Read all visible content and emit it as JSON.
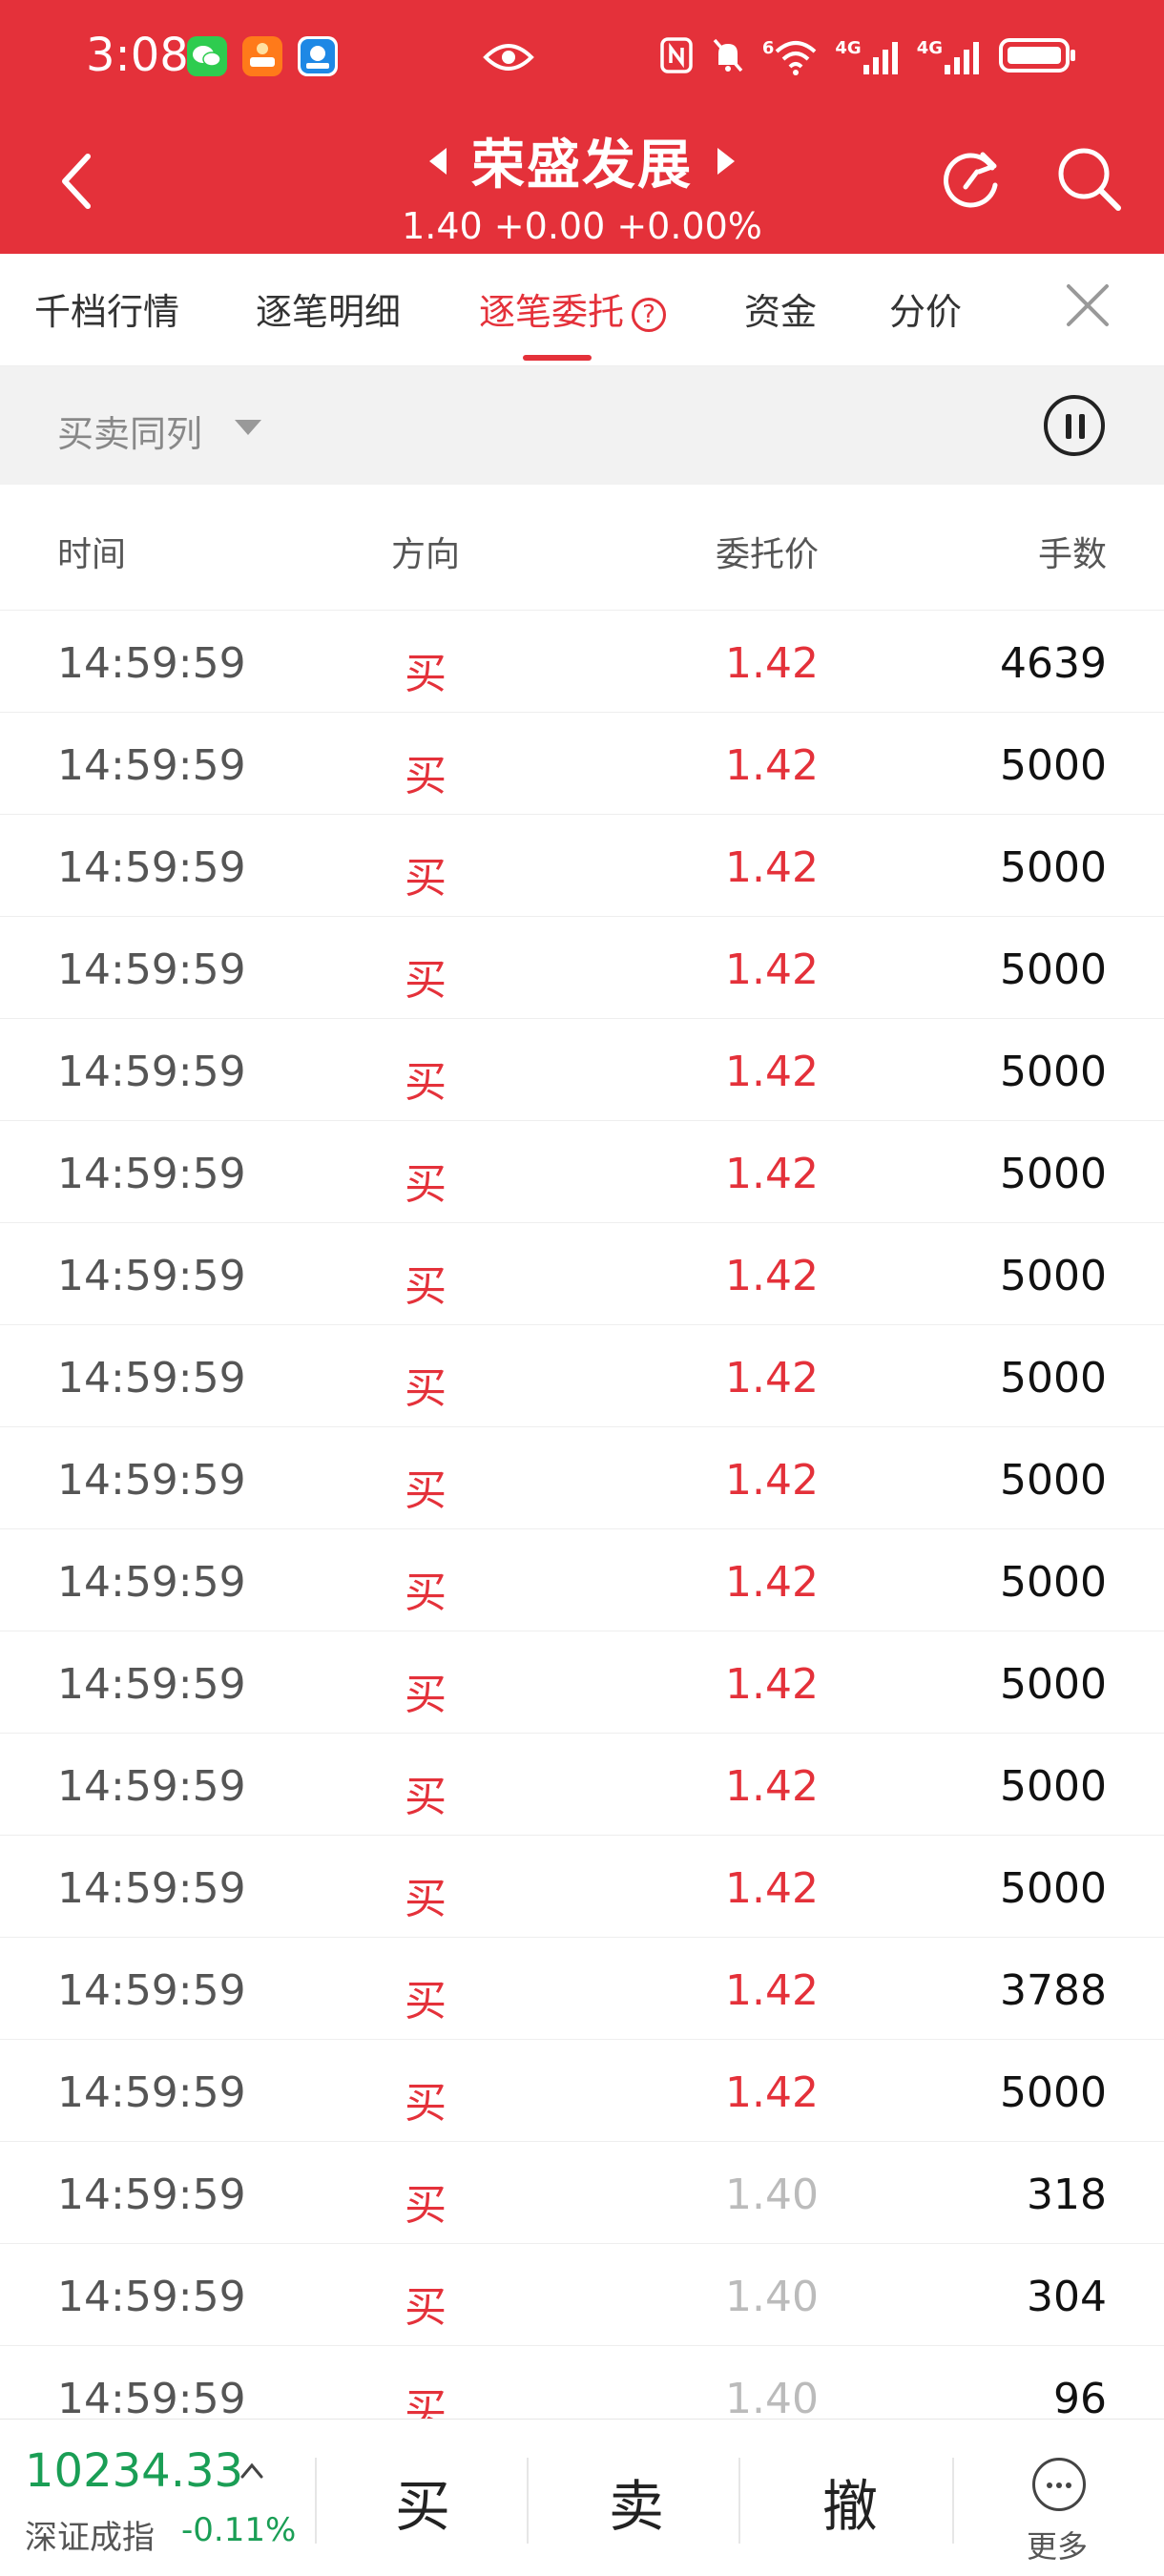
{
  "status_bar": {
    "time": "3:08",
    "apps": [
      "wechat-icon",
      "loan-app-icon",
      "blue-app-icon"
    ],
    "network_labels": [
      "6",
      "4G",
      "4G"
    ]
  },
  "header": {
    "title": "荣盛发展",
    "subtitle": "1.40 +0.00 +0.00%",
    "colors": {
      "bg": "#e4313a",
      "text": "#ffffff"
    }
  },
  "tabs": [
    {
      "label": "千档行情"
    },
    {
      "label": "逐笔明细"
    },
    {
      "label": "逐笔委托",
      "active": true
    },
    {
      "label": "资金"
    },
    {
      "label": "分价"
    }
  ],
  "filter": {
    "label": "买卖同列"
  },
  "table": {
    "headers": [
      "时间",
      "方向",
      "委托价",
      "手数"
    ],
    "rows": [
      {
        "time": "14:59:59",
        "dir": "买",
        "price": "1.42",
        "vol": "4639",
        "state": "up"
      },
      {
        "time": "14:59:59",
        "dir": "买",
        "price": "1.42",
        "vol": "5000",
        "state": "up"
      },
      {
        "time": "14:59:59",
        "dir": "买",
        "price": "1.42",
        "vol": "5000",
        "state": "up"
      },
      {
        "time": "14:59:59",
        "dir": "买",
        "price": "1.42",
        "vol": "5000",
        "state": "up"
      },
      {
        "time": "14:59:59",
        "dir": "买",
        "price": "1.42",
        "vol": "5000",
        "state": "up"
      },
      {
        "time": "14:59:59",
        "dir": "买",
        "price": "1.42",
        "vol": "5000",
        "state": "up"
      },
      {
        "time": "14:59:59",
        "dir": "买",
        "price": "1.42",
        "vol": "5000",
        "state": "up"
      },
      {
        "time": "14:59:59",
        "dir": "买",
        "price": "1.42",
        "vol": "5000",
        "state": "up"
      },
      {
        "time": "14:59:59",
        "dir": "买",
        "price": "1.42",
        "vol": "5000",
        "state": "up"
      },
      {
        "time": "14:59:59",
        "dir": "买",
        "price": "1.42",
        "vol": "5000",
        "state": "up"
      },
      {
        "time": "14:59:59",
        "dir": "买",
        "price": "1.42",
        "vol": "5000",
        "state": "up"
      },
      {
        "time": "14:59:59",
        "dir": "买",
        "price": "1.42",
        "vol": "5000",
        "state": "up"
      },
      {
        "time": "14:59:59",
        "dir": "买",
        "price": "1.42",
        "vol": "5000",
        "state": "up"
      },
      {
        "time": "14:59:59",
        "dir": "买",
        "price": "1.42",
        "vol": "3788",
        "state": "up"
      },
      {
        "time": "14:59:59",
        "dir": "买",
        "price": "1.42",
        "vol": "5000",
        "state": "up"
      },
      {
        "time": "14:59:59",
        "dir": "买",
        "price": "1.40",
        "vol": "318",
        "state": "flat"
      },
      {
        "time": "14:59:59",
        "dir": "买",
        "price": "1.40",
        "vol": "304",
        "state": "flat"
      },
      {
        "time": "14:59:59",
        "dir": "买",
        "price": "1.40",
        "vol": "96",
        "state": "flat"
      }
    ]
  },
  "bottom": {
    "index_value": "10234.33",
    "index_name": "深证成指",
    "index_change": "-0.11%",
    "buy_label": "买",
    "sell_label": "卖",
    "cancel_label": "撤",
    "more_label": "更多",
    "colors": {
      "down": "#1a9e55",
      "up": "#e4313a",
      "flat": "#bbbbbb"
    }
  }
}
